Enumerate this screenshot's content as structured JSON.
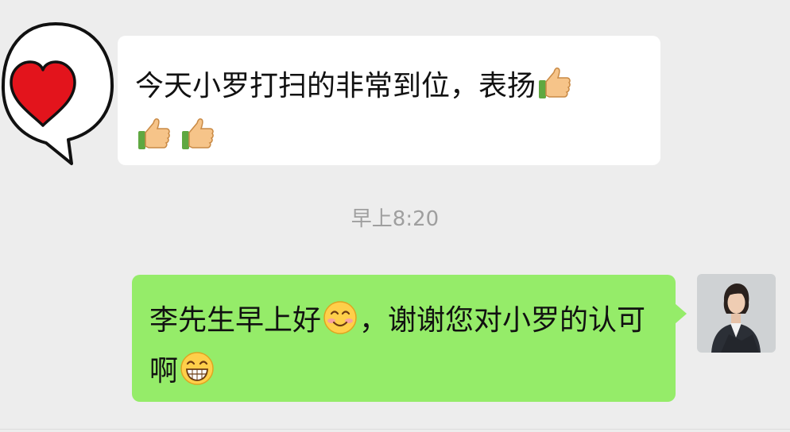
{
  "chat": {
    "incoming": {
      "text": "今天小罗打扫的非常到位，表扬",
      "emojis": [
        "thumbs-up",
        "thumbs-up",
        "thumbs-up"
      ]
    },
    "timestamp": "早上8:20",
    "outgoing": {
      "text_part1": "李先生早上好",
      "emoji_1": "smiling-face",
      "text_part2": "，谢谢您对小罗的认可啊",
      "emoji_2": "grinning-face"
    }
  },
  "colors": {
    "background": "#ededed",
    "incoming_bubble": "#ffffff",
    "outgoing_bubble": "#95ec69",
    "timestamp_text": "#9f9f9f",
    "heart": "#e3141c"
  }
}
